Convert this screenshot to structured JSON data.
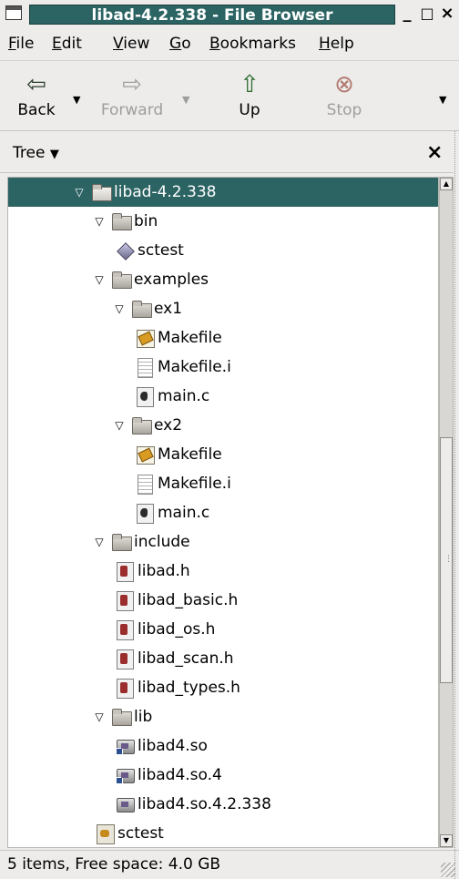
{
  "window": {
    "title": "libad-4.2.338 - File Browser",
    "minimize_glyph": "_",
    "maximize_glyph": "□",
    "close_glyph": "×",
    "icon": "window-menu-icon"
  },
  "menubar": {
    "file": {
      "mnemonic": "F",
      "rest": "ile"
    },
    "edit": {
      "mnemonic": "E",
      "rest": "dit"
    },
    "view": {
      "mnemonic": "V",
      "rest": "iew"
    },
    "go": {
      "mnemonic": "G",
      "rest": "o"
    },
    "bookmarks": {
      "mnemonic": "B",
      "rest": "ookmarks"
    },
    "help": {
      "mnemonic": "H",
      "rest": "elp"
    }
  },
  "toolbar": {
    "back": {
      "label": "Back",
      "icon": "arrow-left-icon",
      "glyph": "⇦"
    },
    "forward": {
      "label": "Forward",
      "icon": "arrow-right-icon",
      "glyph": "⇨",
      "disabled": true
    },
    "up": {
      "label": "Up",
      "icon": "arrow-up-icon",
      "glyph": "⇧"
    },
    "stop": {
      "label": "Stop",
      "icon": "stop-icon",
      "glyph": "⊗",
      "disabled": true
    },
    "dropdown_glyph": "▼"
  },
  "side_pane": {
    "selector": "Tree",
    "selector_glyph": "▼",
    "close_glyph": "×"
  },
  "tree": [
    {
      "name": "libad-4.2.338",
      "type": "folder-open",
      "expanded": true,
      "selected": true
    },
    {
      "name": "bin",
      "type": "folder",
      "expanded": true
    },
    {
      "name": "sctest",
      "type": "executable"
    },
    {
      "name": "examples",
      "type": "folder",
      "expanded": true
    },
    {
      "name": "ex1",
      "type": "folder",
      "expanded": true
    },
    {
      "name": "Makefile",
      "type": "makefile"
    },
    {
      "name": "Makefile.i",
      "type": "text"
    },
    {
      "name": "main.c",
      "type": "c-source"
    },
    {
      "name": "ex2",
      "type": "folder",
      "expanded": true
    },
    {
      "name": "Makefile",
      "type": "makefile"
    },
    {
      "name": "Makefile.i",
      "type": "text"
    },
    {
      "name": "main.c",
      "type": "c-source"
    },
    {
      "name": "include",
      "type": "folder",
      "expanded": true
    },
    {
      "name": "libad.h",
      "type": "c-header"
    },
    {
      "name": "libad_basic.h",
      "type": "c-header"
    },
    {
      "name": "libad_os.h",
      "type": "c-header"
    },
    {
      "name": "libad_scan.h",
      "type": "c-header"
    },
    {
      "name": "libad_types.h",
      "type": "c-header"
    },
    {
      "name": "lib",
      "type": "folder",
      "expanded": true
    },
    {
      "name": "libad4.so",
      "type": "shared-library-link"
    },
    {
      "name": "libad4.so.4",
      "type": "shared-library-link"
    },
    {
      "name": "libad4.so.4.2.338",
      "type": "shared-library"
    },
    {
      "name": "sctest",
      "type": "script"
    }
  ],
  "tree_glyphs": {
    "expanded": "▽"
  },
  "scrollbar": {
    "up_glyph": "▲",
    "down_glyph": "▼",
    "grip_glyph": "⋮"
  },
  "status": {
    "text": "5 items, Free space: 4.0 GB"
  }
}
